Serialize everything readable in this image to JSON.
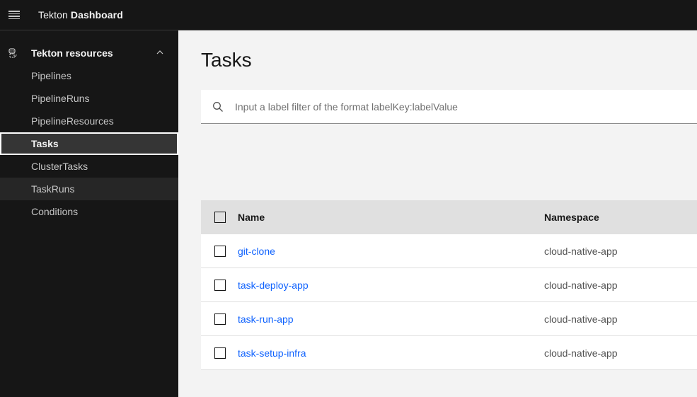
{
  "header": {
    "menu_icon": "hamburger-menu-icon",
    "title_prefix": "Tekton",
    "title_bold": "Dashboard"
  },
  "sidebar": {
    "section": {
      "icon": "tekton-cat-icon",
      "label": "Tekton resources",
      "expanded": true,
      "chevron_icon": "chevron-up-icon"
    },
    "items": [
      {
        "label": "Pipelines",
        "active": false
      },
      {
        "label": "PipelineRuns",
        "active": false
      },
      {
        "label": "PipelineResources",
        "active": false
      },
      {
        "label": "Tasks",
        "active": true
      },
      {
        "label": "ClusterTasks",
        "active": false
      },
      {
        "label": "TaskRuns",
        "active": false,
        "hovered": true
      },
      {
        "label": "Conditions",
        "active": false
      }
    ]
  },
  "main": {
    "title": "Tasks",
    "search": {
      "icon": "search-icon",
      "value": "",
      "placeholder": "Input a label filter of the format labelKey:labelValue"
    },
    "table": {
      "columns": [
        "Name",
        "Namespace"
      ],
      "rows": [
        {
          "name": "git-clone",
          "namespace": "cloud-native-app"
        },
        {
          "name": "task-deploy-app",
          "namespace": "cloud-native-app"
        },
        {
          "name": "task-run-app",
          "namespace": "cloud-native-app"
        },
        {
          "name": "task-setup-infra",
          "namespace": "cloud-native-app"
        }
      ]
    }
  },
  "colors": {
    "header_bg": "#161616",
    "sidebar_bg": "#161616",
    "link": "#0f62fe",
    "page_bg": "#f3f3f3"
  }
}
